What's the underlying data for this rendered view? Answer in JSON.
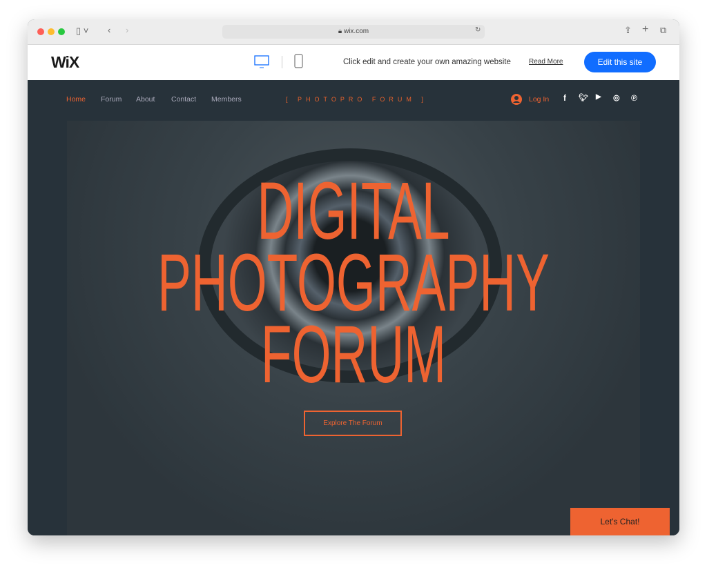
{
  "browser": {
    "url": "wix.com"
  },
  "wixbar": {
    "logo": "WiX",
    "message": "Click edit and create your own amazing website",
    "read_more": "Read More",
    "edit_button": "Edit this site"
  },
  "site": {
    "nav": [
      "Home",
      "Forum",
      "About",
      "Contact",
      "Members"
    ],
    "brand": "[ PHOTOPRO FORUM ]",
    "login": "Log In",
    "hero_lines": [
      "DIGITAL",
      "PHOTOGRAPHY",
      "FORUM"
    ],
    "cta": "Explore The Forum",
    "chat": "Let's Chat!"
  },
  "colors": {
    "accent": "#ee6331",
    "bg": "#27323a",
    "wix_blue": "#116dff"
  }
}
